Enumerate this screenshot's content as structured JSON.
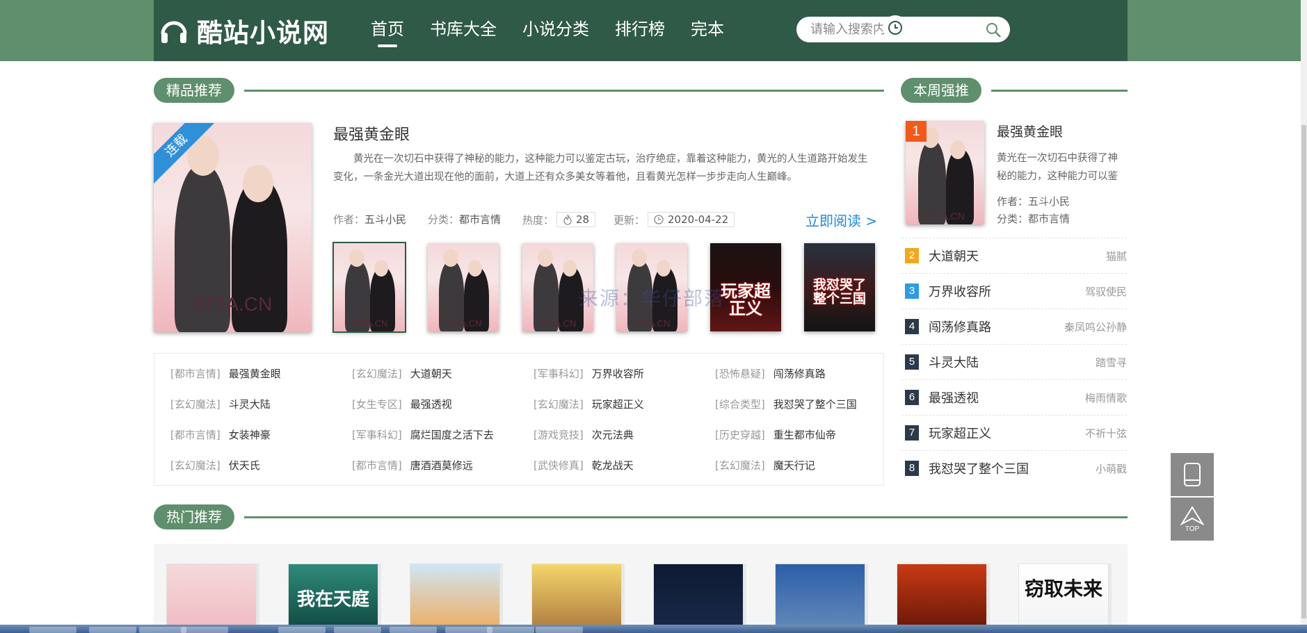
{
  "header": {
    "site_name": "酷站小说网",
    "nav": [
      "首页",
      "书库大全",
      "小说分类",
      "排行榜",
      "完本"
    ],
    "search_placeholder": "请输入搜索内容！",
    "history_label": "阅读历史"
  },
  "featured": {
    "section_title": "精品推荐",
    "ribbon": "连载",
    "cover_mark": "677A.CN",
    "title": "最强黄金眼",
    "description": "黄光在一次切石中获得了神秘的能力，这种能力可以鉴定古玩，治疗绝症，靠着这种能力，黄光的人生道路开始发生变化，一条金光大道出现在他的面前，大道上还有众多美女等着他，且看黄光怎样一步步走向人生巅峰。",
    "author_label": "作者：",
    "author": "五斗小民",
    "category_label": "分类：",
    "category": "都市言情",
    "heat_label": "热度：",
    "heat": "28",
    "update_label": "更新：",
    "update": "2020-04-22",
    "read_now": "立即阅读 >",
    "thumbs": [
      {
        "mark": "677A.CN"
      },
      {
        "mark": "677A.CN"
      },
      {
        "mark": "677A.CN"
      },
      {
        "mark": "677A.CN"
      },
      {
        "title": "玩家超正义"
      },
      {
        "title": "我怼哭了整个三国"
      }
    ],
    "watermark": "来源：华仔部落"
  },
  "category_list": [
    {
      "tag": "[都市言情]",
      "name": "最强黄金眼"
    },
    {
      "tag": "[玄幻魔法]",
      "name": "大道朝天"
    },
    {
      "tag": "[军事科幻]",
      "name": "万界收容所"
    },
    {
      "tag": "[恐怖悬疑]",
      "name": "闯荡修真路"
    },
    {
      "tag": "[玄幻魔法]",
      "name": "斗灵大陆"
    },
    {
      "tag": "[女生专区]",
      "name": "最强透视"
    },
    {
      "tag": "[玄幻魔法]",
      "name": "玩家超正义"
    },
    {
      "tag": "[综合类型]",
      "name": "我怼哭了整个三国"
    },
    {
      "tag": "[都市言情]",
      "name": "女装神豪"
    },
    {
      "tag": "[军事科幻]",
      "name": "腐烂国度之活下去"
    },
    {
      "tag": "[游戏竞技]",
      "name": "次元法典"
    },
    {
      "tag": "[历史穿越]",
      "name": "重生都市仙帝"
    },
    {
      "tag": "[玄幻魔法]",
      "name": "伏天氏"
    },
    {
      "tag": "[都市言情]",
      "name": "唐酒酒莫修远"
    },
    {
      "tag": "[武侠修真]",
      "name": "乾龙战天"
    },
    {
      "tag": "[玄幻魔法]",
      "name": "魔天行记"
    }
  ],
  "weekly": {
    "section_title": "本周强推",
    "top": {
      "num": "1",
      "title": "最强黄金眼",
      "desc": "黄光在一次切石中获得了神秘的能力，这种能力可以鉴",
      "author_label": "作者：",
      "author": "五斗小民",
      "category_label": "分类：",
      "category": "都市言情",
      "cover_mark": "677A.CN"
    },
    "list": [
      {
        "num": "2",
        "title": "大道朝天",
        "author": "猫腻",
        "color": "#f2a81d"
      },
      {
        "num": "3",
        "title": "万界收容所",
        "author": "驾驭使民",
        "color": "#2f9be0"
      },
      {
        "num": "4",
        "title": "闯荡修真路",
        "author": "秦凤鸣公孙静",
        "color": "#2b3a4a"
      },
      {
        "num": "5",
        "title": "斗灵大陆",
        "author": "踏雪寻",
        "color": "#2b3a4a"
      },
      {
        "num": "6",
        "title": "最强透视",
        "author": "梅雨情歌",
        "color": "#2b3a4a"
      },
      {
        "num": "7",
        "title": "玩家超正义",
        "author": "不祈十弦",
        "color": "#2b3a4a"
      },
      {
        "num": "8",
        "title": "我怼哭了整个三国",
        "author": "小萌戳",
        "color": "#2b3a4a"
      }
    ]
  },
  "hot": {
    "section_title": "热门推荐",
    "covers": [
      {
        "text": ""
      },
      {
        "text": "我在天庭"
      },
      {
        "text": ""
      },
      {
        "text": ""
      },
      {
        "text": ""
      },
      {
        "text": ""
      },
      {
        "text": ""
      },
      {
        "text": "窃取未来"
      }
    ]
  },
  "tools": {
    "top_label": "TOP"
  },
  "colors": {
    "header": "#2f5a46",
    "accent": "#5f8f6c",
    "link": "#1e8ad8",
    "rank1": "#f25a1d"
  }
}
